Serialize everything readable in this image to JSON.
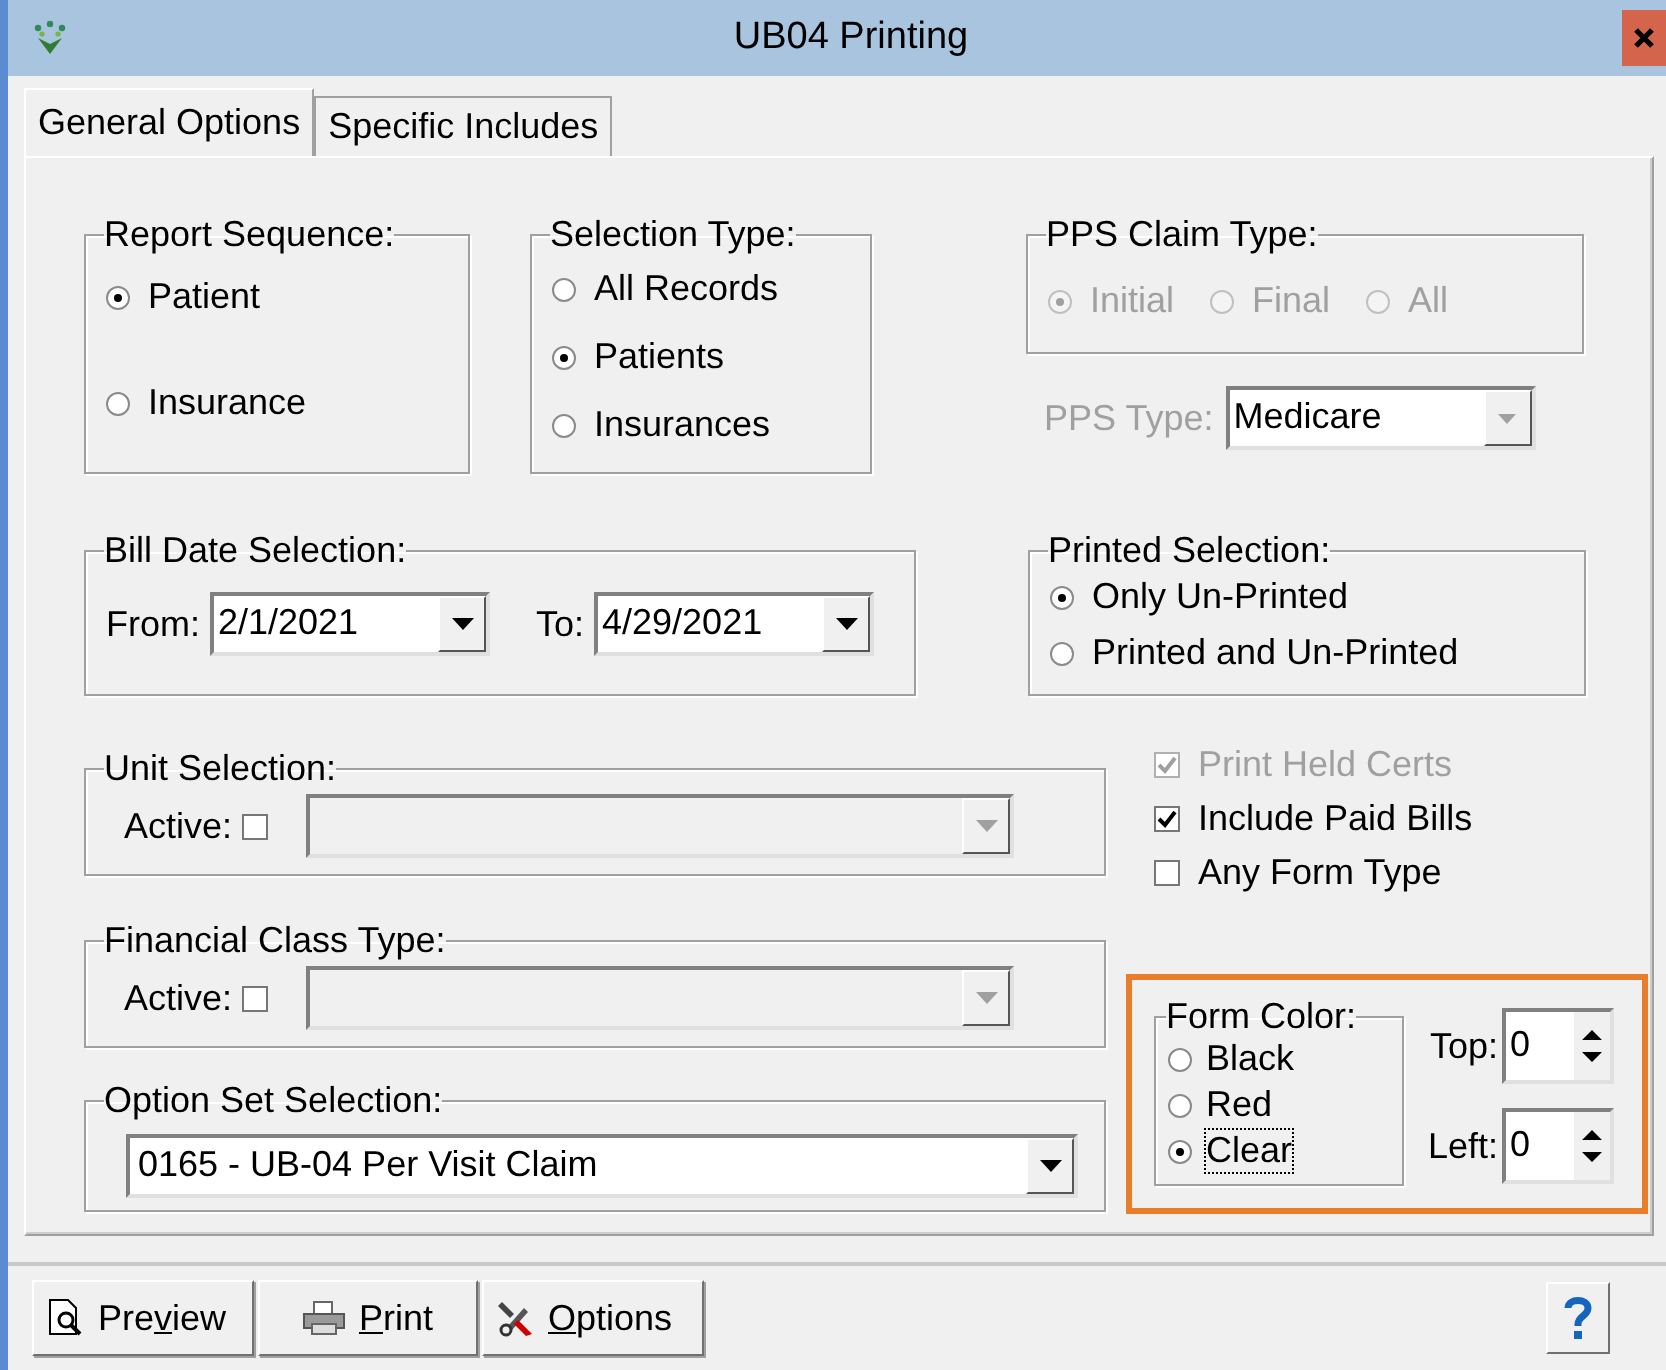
{
  "window": {
    "title": "UB04 Printing"
  },
  "tabs": [
    {
      "label": "General Options",
      "selected": true
    },
    {
      "label": "Specific Includes",
      "selected": false
    }
  ],
  "report_sequence": {
    "title": "Report Sequence:",
    "options": [
      {
        "label": "Patient",
        "selected": true
      },
      {
        "label": "Insurance",
        "selected": false
      }
    ]
  },
  "selection_type": {
    "title": "Selection Type:",
    "options": [
      {
        "label": "All Records",
        "selected": false
      },
      {
        "label": "Patients",
        "selected": true
      },
      {
        "label": "Insurances",
        "selected": false
      }
    ]
  },
  "pps_claim_type": {
    "title": "PPS Claim Type:",
    "disabled": true,
    "options": [
      {
        "label": "Initial",
        "selected": true
      },
      {
        "label": "Final",
        "selected": false
      },
      {
        "label": "All",
        "selected": false
      }
    ]
  },
  "pps_type": {
    "label": "PPS Type:",
    "value": "Medicare",
    "disabled": true
  },
  "bill_date_selection": {
    "title": "Bill Date Selection:",
    "from_label": "From:",
    "from": "2/1/2021",
    "to_label": "To:",
    "to": "4/29/2021"
  },
  "printed_selection": {
    "title": "Printed Selection:",
    "options": [
      {
        "label": "Only Un-Printed",
        "selected": true
      },
      {
        "label": "Printed and Un-Printed",
        "selected": false
      }
    ]
  },
  "unit_selection": {
    "title": "Unit Selection:",
    "active_label": "Active:",
    "active": false
  },
  "financial_class_type": {
    "title": "Financial Class Type:",
    "active_label": "Active:",
    "active": false
  },
  "option_set_selection": {
    "title": "Option Set Selection:",
    "value": "0165 - UB-04 Per Visit Claim"
  },
  "checkboxes": [
    {
      "label": "Print Held Certs",
      "checked": true,
      "disabled": true
    },
    {
      "label": "Include Paid Bills",
      "checked": true,
      "disabled": false
    },
    {
      "label": "Any Form Type",
      "checked": false,
      "disabled": false
    }
  ],
  "form_color": {
    "title": "Form Color:",
    "highlighted": true,
    "options": [
      {
        "label": "Black",
        "selected": false,
        "focused": false
      },
      {
        "label": "Red",
        "selected": false,
        "focused": false
      },
      {
        "label": "Clear",
        "selected": true,
        "focused": true
      }
    ]
  },
  "offsets": [
    {
      "label": "Top:",
      "value": "0"
    },
    {
      "label": "Left:",
      "value": "0"
    }
  ],
  "buttons": [
    {
      "kind": "preview",
      "label_start": "Pre",
      "access_key": "v",
      "label_rest": "iew"
    },
    {
      "kind": "print",
      "access_key": "P",
      "label_rest": "rint"
    },
    {
      "kind": "options",
      "access_key": "O",
      "label_rest": "ptions"
    }
  ]
}
